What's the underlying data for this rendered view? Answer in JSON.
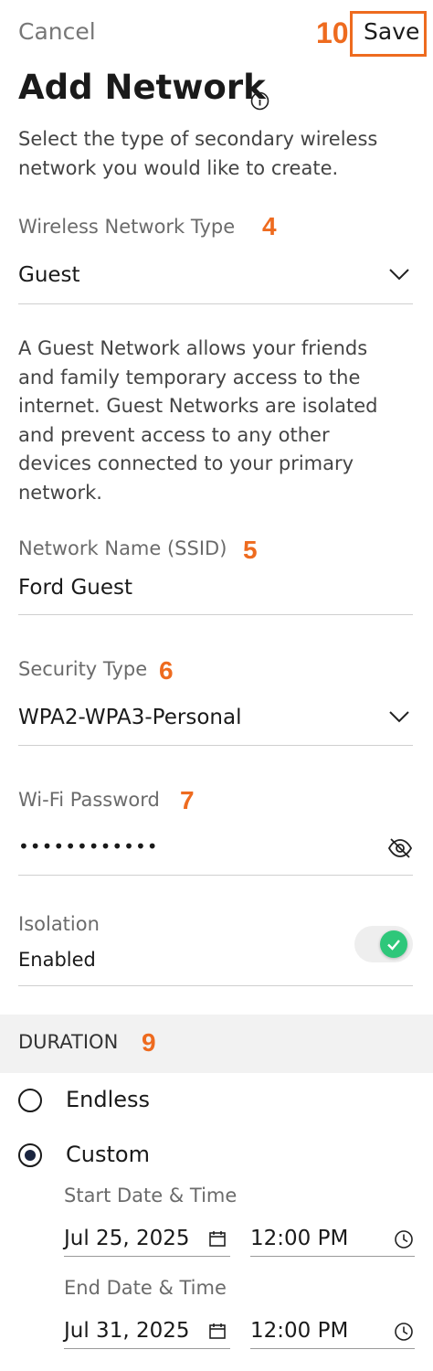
{
  "header": {
    "cancel_label": "Cancel",
    "save_step": "10",
    "save_label": "Save",
    "title": "Add Network",
    "subtitle": "Select the type of secondary wireless network you would like to create."
  },
  "network_type": {
    "label": "Wireless Network Type",
    "step": "4",
    "value": "Guest",
    "description": "A Guest Network allows your friends and family temporary access to the internet. Guest Networks are isolated and prevent access to any other devices connected to your primary network."
  },
  "ssid": {
    "label": "Network Name (SSID)",
    "step": "5",
    "value": "Ford Guest"
  },
  "security": {
    "label": "Security Type",
    "step": "6",
    "value": "WPA2-WPA3-Personal"
  },
  "password": {
    "label": "Wi-Fi Password",
    "step": "7",
    "value": "••••••••••••"
  },
  "isolation": {
    "label": "Isolation",
    "value": "Enabled",
    "enabled": true
  },
  "duration": {
    "heading": "DURATION",
    "step": "9",
    "options": [
      {
        "label": "Endless",
        "selected": false
      },
      {
        "label": "Custom",
        "selected": true
      }
    ],
    "start_label": "Start Date & Time",
    "start_date": "Jul 25, 2025",
    "start_time": "12:00 PM",
    "end_label": "End Date & Time",
    "end_date": "Jul 31, 2025",
    "end_time": "12:00 PM"
  },
  "colors": {
    "accent": "#ee6b1f",
    "toggle_on": "#2ec77a",
    "section_bg": "#f2f2f2"
  }
}
